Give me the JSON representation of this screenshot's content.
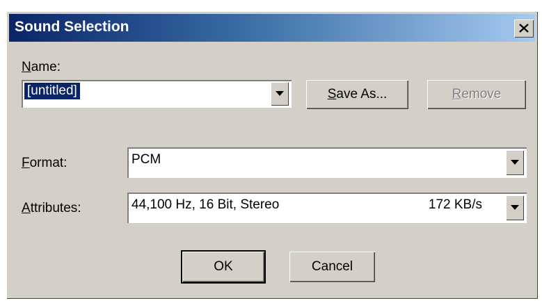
{
  "dialog": {
    "title": "Sound Selection",
    "close_icon": "close-icon"
  },
  "name": {
    "label_mnemonic": "N",
    "label_rest": "ame:",
    "value": "[untitled]",
    "save_as_mnemonic": "S",
    "save_as_rest": "ave As...",
    "remove_mnemonic": "R",
    "remove_rest": "emove"
  },
  "format": {
    "label_mnemonic": "F",
    "label_rest": "ormat:",
    "value": "PCM"
  },
  "attributes": {
    "label_mnemonic": "A",
    "label_rest": "ttributes:",
    "value": "44,100 Hz, 16 Bit, Stereo",
    "rate": "172 KB/s"
  },
  "buttons": {
    "ok": "OK",
    "cancel": "Cancel"
  },
  "colors": {
    "title_gradient_start": "#0a246a",
    "title_gradient_end": "#a6caf0",
    "face": "#d4d0c8",
    "selection": "#0a246a"
  }
}
